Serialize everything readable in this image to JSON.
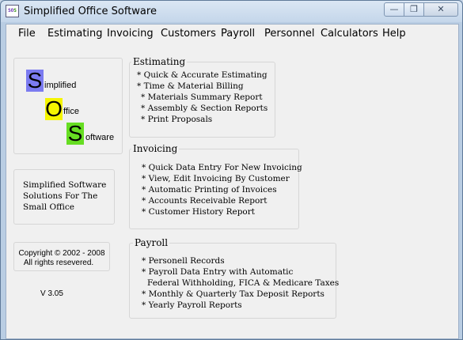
{
  "window": {
    "title": "Simplified Office Software",
    "icon_name": "sos-app-icon",
    "icon_text": [
      "SO",
      "S"
    ],
    "controls": {
      "minimize": "—",
      "maximize": "❐",
      "close": "✕"
    }
  },
  "menubar": [
    "File",
    "Estimating",
    "Invoicing",
    "Customers",
    "Payroll",
    "Personnel",
    "Calculators",
    "Help"
  ],
  "logo": {
    "s1": "S",
    "w1": "implified",
    "o": "O",
    "w2": "ffice",
    "s2": "S",
    "w3": "oftware",
    "colors": {
      "s1": "#7b7bf0",
      "o": "#f5f500",
      "s2": "#66dd22"
    }
  },
  "tagline": [
    "Simplified Software",
    "Solutions For The",
    "Small Office"
  ],
  "copyright": [
    "Copyright © 2002 - 2008",
    "All rights resevered."
  ],
  "version": "V 3.05",
  "estimating": {
    "title": "Estimating",
    "items": [
      " * Quick & Accurate Estimating",
      "* Time & Material Billing",
      "*  Materials Summary Report",
      "*  Assembly & Section Reports",
      "*  Print Proposals"
    ]
  },
  "invoicing": {
    "title": "Invoicing",
    "items": [
      "* Quick Data Entry For New Invoicing",
      "* View, Edit Invoicing By Customer",
      "* Automatic Printing of Invoices",
      "* Accounts Receivable Report",
      "* Customer History Report"
    ]
  },
  "payroll": {
    "title": "Payroll",
    "items": [
      "* Personell Records",
      "* Payroll Data Entry with Automatic",
      "  Federal  Withholding, FICA & Medicare Taxes",
      "* Monthly & Quarterly Tax Deposit Reports",
      "* Yearly Payroll Reports"
    ]
  }
}
